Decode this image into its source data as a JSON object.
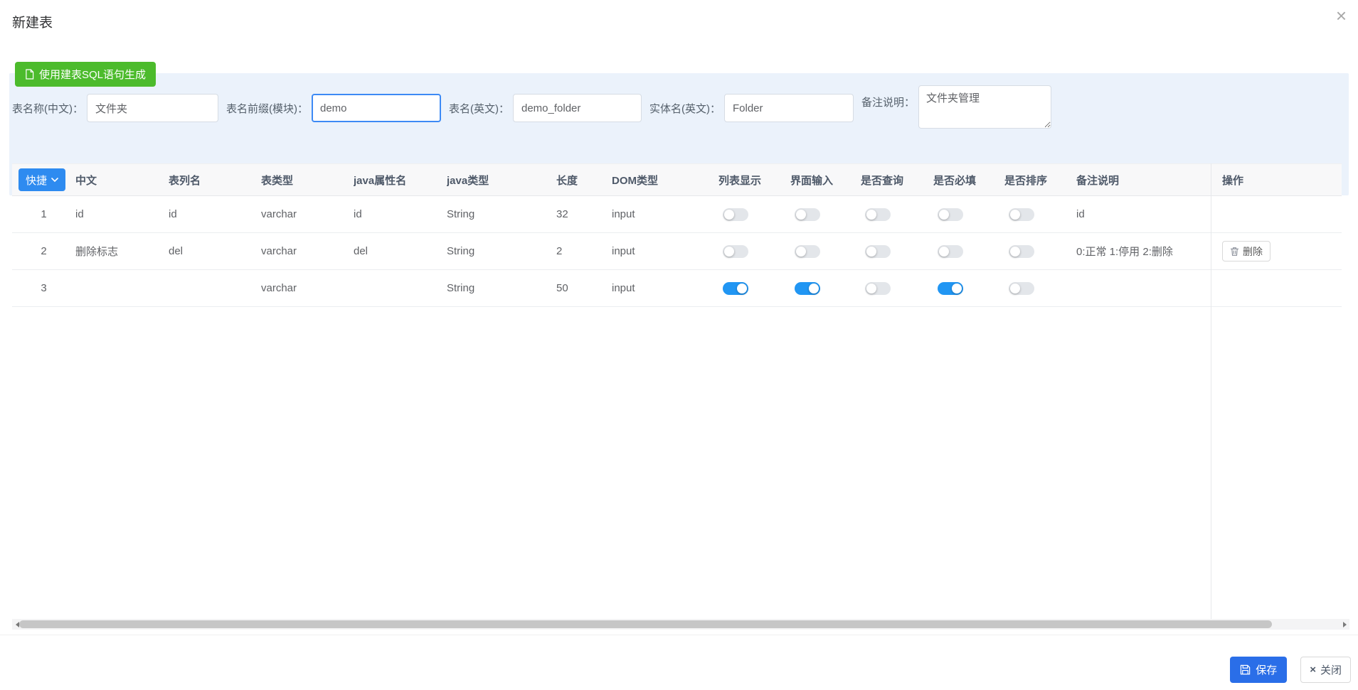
{
  "colors": {
    "panel_background": "#ebf2fb",
    "green_button": "#4cbb2c",
    "quick_button_blue": "#2e8bf0",
    "toggle_on_blue": "#2196f3",
    "save_button_blue": "#2a6ee8"
  },
  "icons": {
    "modal_close": "×",
    "footer_close": "×"
  },
  "modal": {
    "title": "新建表"
  },
  "sql_panel": {
    "generate_button_label": "使用建表SQL语句生成",
    "fields": [
      {
        "label": "表名称(中文)：",
        "value": "文件夹"
      },
      {
        "label": "表名前缀(模块)：",
        "value": "demo"
      },
      {
        "label": "表名(英文)：",
        "value": "demo_folder"
      },
      {
        "label": "实体名(英文)：",
        "value": "Folder"
      },
      {
        "label": "备注说明：",
        "value": "文件夹管理"
      }
    ]
  },
  "table": {
    "quick_button_label": "快捷",
    "headers": {
      "chinese": "中文",
      "column_name": "表列名",
      "db_type": "表类型",
      "java_field": "java属性名",
      "java_type": "java类型",
      "length": "长度",
      "dom_type": "DOM类型",
      "list_show": "列表显示",
      "form_input": "界面输入",
      "is_query": "是否查询",
      "is_required": "是否必填",
      "is_sort": "是否排序",
      "remark": "备注说明",
      "action": "操作"
    },
    "delete_button_label": "删除",
    "rows": [
      {
        "num": "1",
        "chinese": "id",
        "column_name": "id",
        "db_type": "varchar",
        "java_field": "id",
        "java_type": "String",
        "length": "32",
        "dom_type": "input",
        "toggles": {
          "list_show": false,
          "form_input": false,
          "is_query": false,
          "is_required": false,
          "is_sort": false
        },
        "remark": "id",
        "has_delete_button": false
      },
      {
        "num": "2",
        "chinese": "删除标志",
        "column_name": "del",
        "db_type": "varchar",
        "java_field": "del",
        "java_type": "String",
        "length": "2",
        "dom_type": "input",
        "toggles": {
          "list_show": false,
          "form_input": false,
          "is_query": false,
          "is_required": false,
          "is_sort": false
        },
        "remark": "0:正常 1:停用 2:删除",
        "has_delete_button": true
      },
      {
        "num": "3",
        "chinese": "",
        "column_name": "",
        "db_type": "varchar",
        "java_field": "",
        "java_type": "String",
        "length": "50",
        "dom_type": "input",
        "toggles": {
          "list_show": true,
          "form_input": true,
          "is_query": false,
          "is_required": true,
          "is_sort": false
        },
        "remark": "",
        "has_delete_button": false
      }
    ]
  },
  "footer": {
    "save_label": "保存",
    "close_label": "关闭"
  }
}
